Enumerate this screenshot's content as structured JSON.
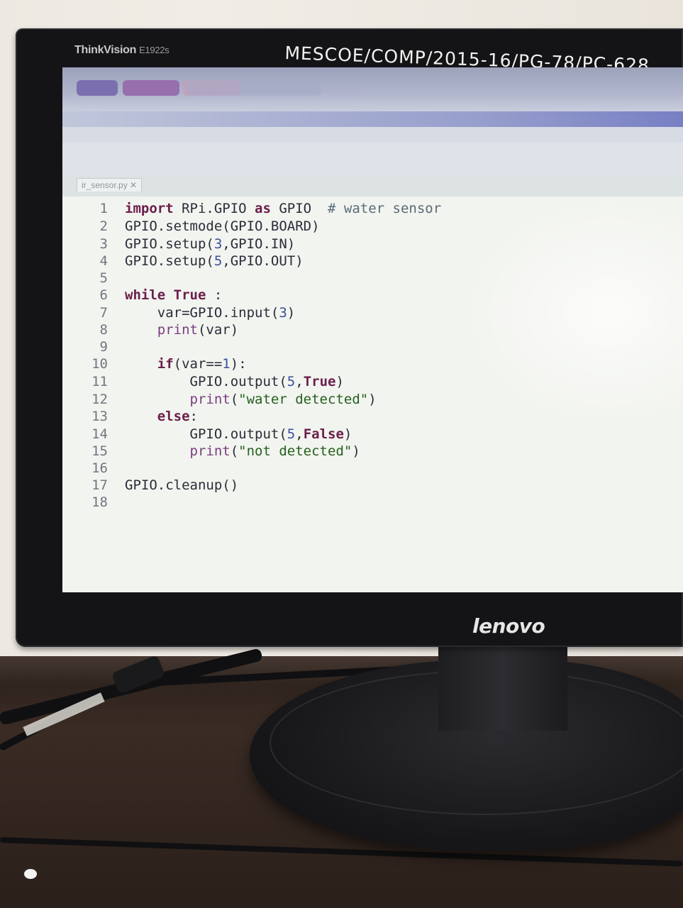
{
  "monitor": {
    "brand_label": "ThinkVision",
    "model_label": "E1922s",
    "asset_tag": "MESCOE/COMP/2015-16/PG-78/PC-628",
    "manufacturer_logo": "lenovo"
  },
  "editor": {
    "tab_label": "ir_sensor.py ✕",
    "lines": [
      {
        "n": "1",
        "text": "import RPi.GPIO as GPIO  # water sensor"
      },
      {
        "n": "2",
        "text": "GPIO.setmode(GPIO.BOARD)"
      },
      {
        "n": "3",
        "text": "GPIO.setup(3,GPIO.IN)"
      },
      {
        "n": "4",
        "text": "GPIO.setup(5,GPIO.OUT)"
      },
      {
        "n": "5",
        "text": ""
      },
      {
        "n": "6",
        "text": "while True :"
      },
      {
        "n": "7",
        "text": "    var=GPIO.input(3)"
      },
      {
        "n": "8",
        "text": "    print(var)"
      },
      {
        "n": "9",
        "text": ""
      },
      {
        "n": "10",
        "text": "    if(var==1):"
      },
      {
        "n": "11",
        "text": "        GPIO.output(5,True)"
      },
      {
        "n": "12",
        "text": "        print(\"water detected\")"
      },
      {
        "n": "13",
        "text": "    else:"
      },
      {
        "n": "14",
        "text": "        GPIO.output(5,False)"
      },
      {
        "n": "15",
        "text": "        print(\"not detected\")"
      },
      {
        "n": "16",
        "text": ""
      },
      {
        "n": "17",
        "text": "GPIO.cleanup()"
      },
      {
        "n": "18",
        "text": ""
      }
    ]
  },
  "colors": {
    "keyword": "#6b1e4b",
    "number": "#3a4fa0",
    "string": "#24601e",
    "comment": "#5a6a78"
  }
}
